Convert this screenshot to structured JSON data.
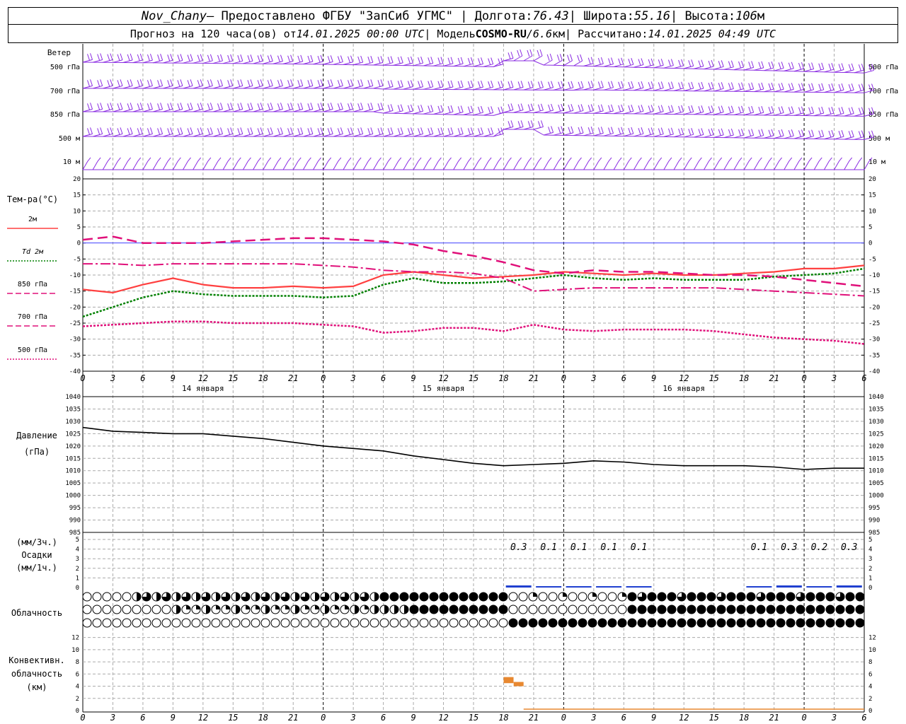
{
  "header": {
    "station": "Nov_Chany",
    "provider": " — Предоставлено ФГБУ \"ЗапСиб УГМС\" | Долгота: ",
    "lon": "76.43",
    "lat_label": " | Широта: ",
    "lat": "55.16",
    "alt_label": " | Высота: ",
    "alt": "106",
    "alt_unit": "м",
    "fc_label": "Прогноз на 120 часа(ов) от ",
    "fc_from": "14.01.2025 00:00 UTC",
    "model_label": "  | Модель ",
    "model": "COSMO-RU",
    "res_sep": " / ",
    "res": "6.6",
    "res_unit": "км",
    "calc_label": " | Рассчитано: ",
    "calc": "14.01.2025 04:49 UTC"
  },
  "colors": {
    "wind": "#8a2be2",
    "t2m": "#ff4040",
    "td2m": "#008000",
    "t850": "#e0107a",
    "t700": "#e0107a",
    "t500": "#e0107a",
    "pressure": "#000000",
    "precip": "#2040d0",
    "convective": "#e88830",
    "zero_line": "#4040ff",
    "grid": "#aaaaaa"
  },
  "chart_data": [
    {
      "type": "wind",
      "name": "wind",
      "label": "Ветер",
      "levels": [
        "500 гПа",
        "700 гПа",
        "850 гПа",
        "500 м",
        "10  м"
      ]
    },
    {
      "type": "line",
      "name": "temperature",
      "label": "Тем-ра(°C)",
      "legend": [
        "2м",
        "Td  2м",
        "850 гПа",
        "700 гПа",
        "500 гПа"
      ],
      "ylim": [
        -40,
        20
      ],
      "yticks": [
        20,
        15,
        10,
        5,
        0,
        -5,
        -10,
        -15,
        -20,
        -25,
        -30,
        -35,
        -40
      ],
      "x": [
        0,
        3,
        6,
        9,
        12,
        15,
        18,
        21,
        24,
        27,
        30,
        33,
        36,
        39,
        42,
        45,
        48,
        51,
        54,
        57,
        60,
        63,
        66,
        69,
        72,
        75,
        78
      ],
      "series": [
        {
          "name": "2м",
          "values": [
            -14.5,
            -15.5,
            -13,
            -11,
            -13,
            -14,
            -14,
            -13.5,
            -14,
            -13.5,
            -10,
            -9,
            -10,
            -11,
            -10.5,
            -10,
            -9,
            -9.5,
            -10,
            -9.5,
            -10,
            -10,
            -9.5,
            -9,
            -8,
            -8,
            -7
          ]
        },
        {
          "name": "Td  2м",
          "values": [
            -23,
            -20,
            -17,
            -15,
            -16,
            -16.5,
            -16.5,
            -16.5,
            -17,
            -16.5,
            -13,
            -11,
            -12.5,
            -12.5,
            -12,
            -11,
            -10,
            -11,
            -11.5,
            -11,
            -11.5,
            -11.5,
            -11.5,
            -10.5,
            -10,
            -9.5,
            -8
          ]
        },
        {
          "name": "850 гПа",
          "values": [
            1,
            2,
            0,
            0,
            0,
            0.5,
            1,
            1.5,
            1.5,
            1,
            0.5,
            -0.5,
            -2.5,
            -4,
            -6,
            -8.5,
            -9.5,
            -8.5,
            -9,
            -9,
            -9.5,
            -10,
            -10,
            -10.5,
            -11.5,
            -12.5,
            -13.5
          ]
        },
        {
          "name": "700 гПа",
          "values": [
            -6.5,
            -6.5,
            -7,
            -6.5,
            -6.5,
            -6.5,
            -6.5,
            -6.5,
            -7,
            -7.5,
            -8.5,
            -9,
            -9,
            -9.5,
            -11,
            -15,
            -14.5,
            -14,
            -14,
            -14,
            -14,
            -14,
            -14.5,
            -15,
            -15.5,
            -16,
            -16.5
          ]
        },
        {
          "name": "500 гПа",
          "values": [
            -26,
            -25.5,
            -25,
            -24.5,
            -24.5,
            -25,
            -25,
            -25,
            -25.5,
            -26,
            -28,
            -27.5,
            -26.5,
            -26.5,
            -27.5,
            -25.5,
            -27,
            -27.5,
            -27,
            -27,
            -27,
            -27.5,
            -28.5,
            -29.5,
            -30,
            -30.5,
            -31.5
          ]
        }
      ]
    },
    {
      "type": "line",
      "name": "pressure",
      "label": "Давление",
      "unit": "(гПа)",
      "ylim": [
        985,
        1040
      ],
      "yticks": [
        1040,
        1035,
        1030,
        1025,
        1020,
        1015,
        1010,
        1005,
        1000,
        995,
        990,
        985
      ],
      "x": [
        0,
        3,
        6,
        9,
        12,
        15,
        18,
        21,
        24,
        27,
        30,
        33,
        36,
        39,
        42,
        45,
        48,
        51,
        54,
        57,
        60,
        63,
        66,
        69,
        72,
        75,
        78
      ],
      "values": [
        1027.5,
        1026,
        1025.5,
        1025,
        1025,
        1024,
        1023,
        1021.5,
        1020,
        1019,
        1018,
        1016,
        1014.5,
        1013,
        1012,
        1012.5,
        1013,
        1014,
        1013.5,
        1012.5,
        1012,
        1012,
        1012,
        1011.5,
        1010.5,
        1011,
        1011
      ]
    },
    {
      "type": "bar",
      "name": "precipitation",
      "label_units": "(мм/3ч.)",
      "label": "Осадки",
      "label_units2": "(мм/1ч.)",
      "ylim": [
        0,
        5
      ],
      "yticks": [
        5,
        4,
        3,
        2,
        1,
        0
      ],
      "x": [
        43.5,
        46.5,
        49.5,
        52.5,
        55.5,
        67.5,
        70.5,
        73.5,
        76.5
      ],
      "amount_labels": [
        "0.3",
        "0.1",
        "0.1",
        "0.1",
        "0.1",
        "0.1",
        "0.3",
        "0.2",
        "0.3"
      ],
      "values": [
        0.3,
        0.1,
        0.1,
        0.1,
        0.1,
        0.1,
        0.3,
        0.2,
        0.3
      ]
    },
    {
      "type": "table",
      "name": "cloudiness",
      "label": "Облачность"
    },
    {
      "type": "bar",
      "name": "convective-cloud",
      "label": "Конвективн.",
      "label2": "облачность",
      "unit": "(км)",
      "ylim": [
        0,
        13
      ],
      "yticks": [
        12,
        10,
        8,
        6,
        4,
        2,
        0
      ],
      "bars": [
        {
          "x": 42.5,
          "bottom": 4.5,
          "top": 5.5
        },
        {
          "x": 43.5,
          "bottom": 4,
          "top": 4.7
        }
      ]
    }
  ],
  "xaxis": {
    "hour_labels": [
      "0",
      "3",
      "6",
      "9",
      "12",
      "15",
      "18",
      "21",
      "0",
      "3",
      "6",
      "9",
      "12",
      "15",
      "18",
      "21",
      "0",
      "3",
      "6",
      "9",
      "12",
      "15",
      "18",
      "21",
      "0",
      "3",
      "6"
    ],
    "day_labels": [
      "14 января",
      "15 января",
      "16 января"
    ]
  }
}
